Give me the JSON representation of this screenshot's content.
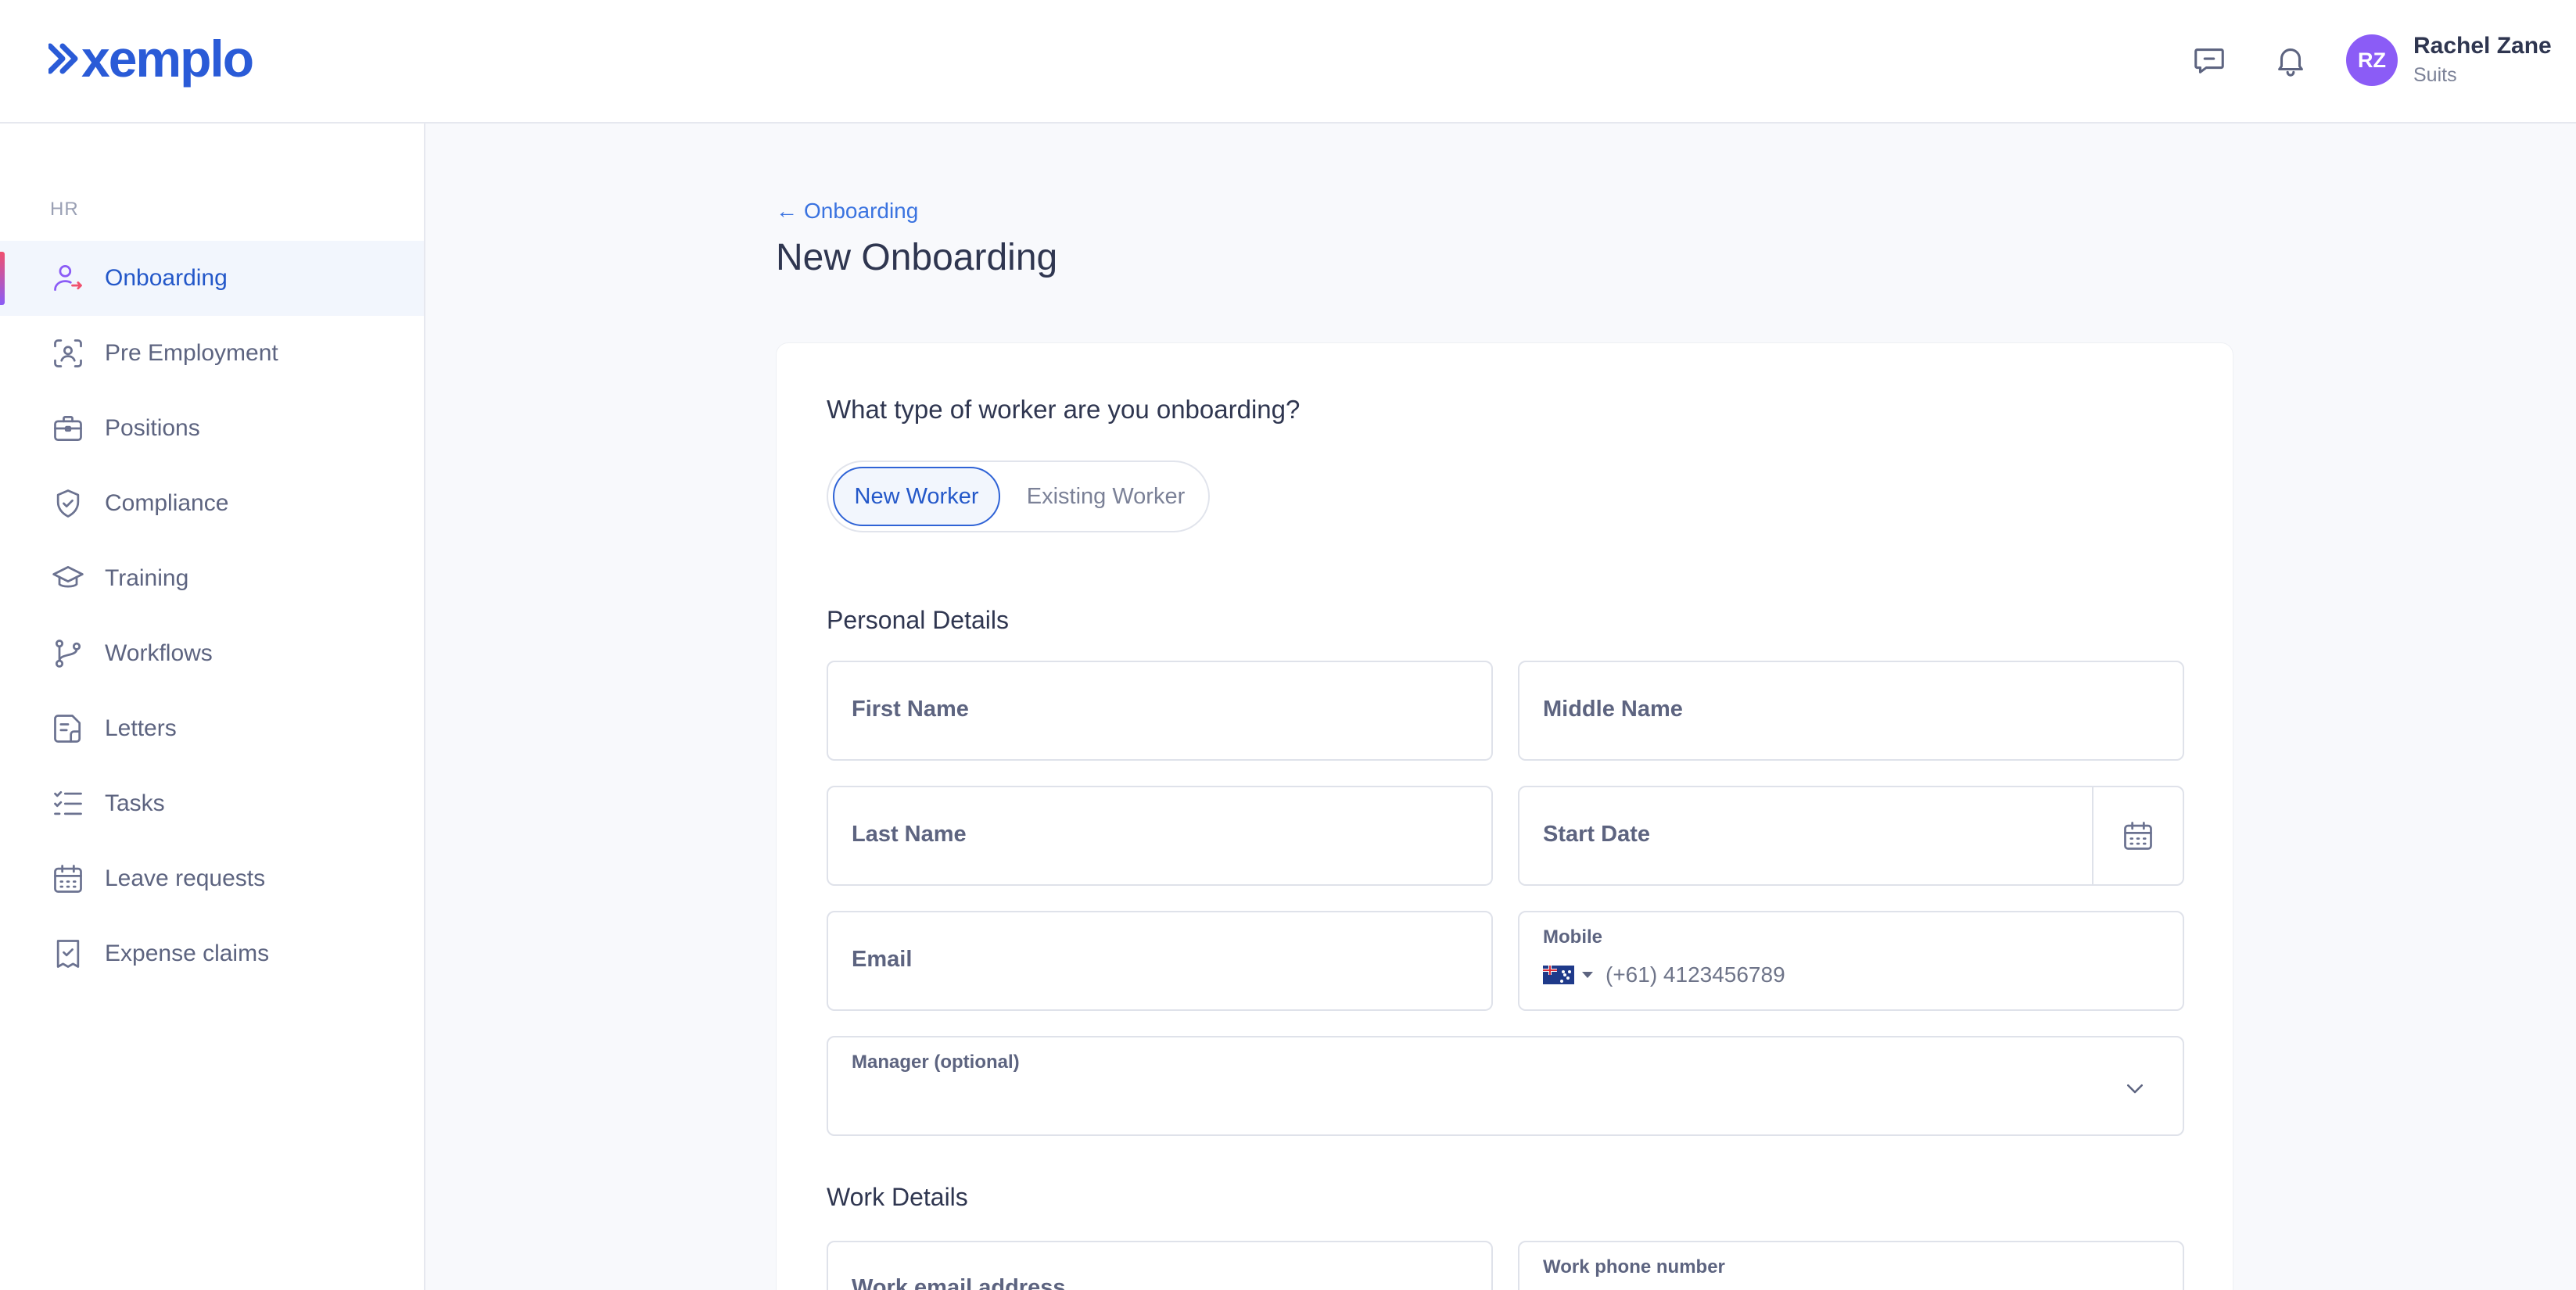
{
  "brand": {
    "logo_text": "xemplo",
    "accent": "#2a5bd7"
  },
  "header": {
    "icons": [
      "chat-icon",
      "bell-icon"
    ],
    "user": {
      "initials": "RZ",
      "name": "Rachel Zane",
      "org": "Suits",
      "avatar_color": "#8b5cf6"
    }
  },
  "sidebar": {
    "section": "HR",
    "items": [
      {
        "label": "Onboarding",
        "icon": "user-arrow-icon",
        "active": true
      },
      {
        "label": "Pre Employment",
        "icon": "scan-user-icon"
      },
      {
        "label": "Positions",
        "icon": "briefcase-icon"
      },
      {
        "label": "Compliance",
        "icon": "shield-check-icon"
      },
      {
        "label": "Training",
        "icon": "graduation-cap-icon"
      },
      {
        "label": "Workflows",
        "icon": "git-branch-icon"
      },
      {
        "label": "Letters",
        "icon": "document-icon"
      },
      {
        "label": "Tasks",
        "icon": "checklist-icon"
      },
      {
        "label": "Leave requests",
        "icon": "calendar-icon"
      },
      {
        "label": "Expense claims",
        "icon": "receipt-icon"
      }
    ]
  },
  "main": {
    "back_link": "Onboarding",
    "title": "New Onboarding",
    "question": "What type of worker are you onboarding?",
    "toggle": {
      "selected": "New Worker",
      "other": "Existing Worker"
    },
    "personal_details": {
      "title": "Personal Details",
      "first_name": "First Name",
      "middle_name": "Middle Name",
      "last_name": "Last Name",
      "start_date": "Start Date",
      "email": "Email",
      "mobile_label": "Mobile",
      "mobile_placeholder": "(+61) 4123456789",
      "manager_label": "Manager (optional)"
    },
    "work_details": {
      "title": "Work Details",
      "work_email": "Work email address",
      "work_phone_label": "Work phone number"
    }
  }
}
